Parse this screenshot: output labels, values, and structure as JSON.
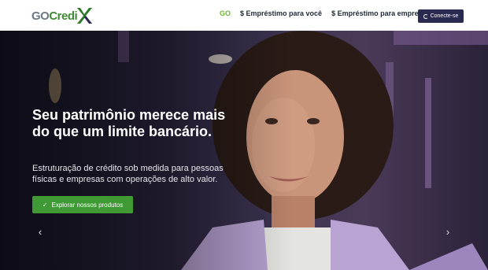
{
  "logo": {
    "part1": "GO",
    "part2": "Credi"
  },
  "nav": {
    "items": [
      "GO",
      "$ Empréstimo para você",
      "$ Empréstimo para empresa"
    ],
    "cta_label": "Conecte-se"
  },
  "hero": {
    "headline": "Seu patrimônio merece mais do que um limite bancário.",
    "subheadline": "Estruturação de crédito sob medida para pessoas físicas e empresas com operações de alto valor.",
    "button_label": "Explorar nossos produtos",
    "arrow_prev": "‹",
    "arrow_next": "›"
  },
  "colors": {
    "brand_green": "#3f9a35",
    "brand_dark": "#2a2950",
    "nav_active": "#6bb52e"
  }
}
